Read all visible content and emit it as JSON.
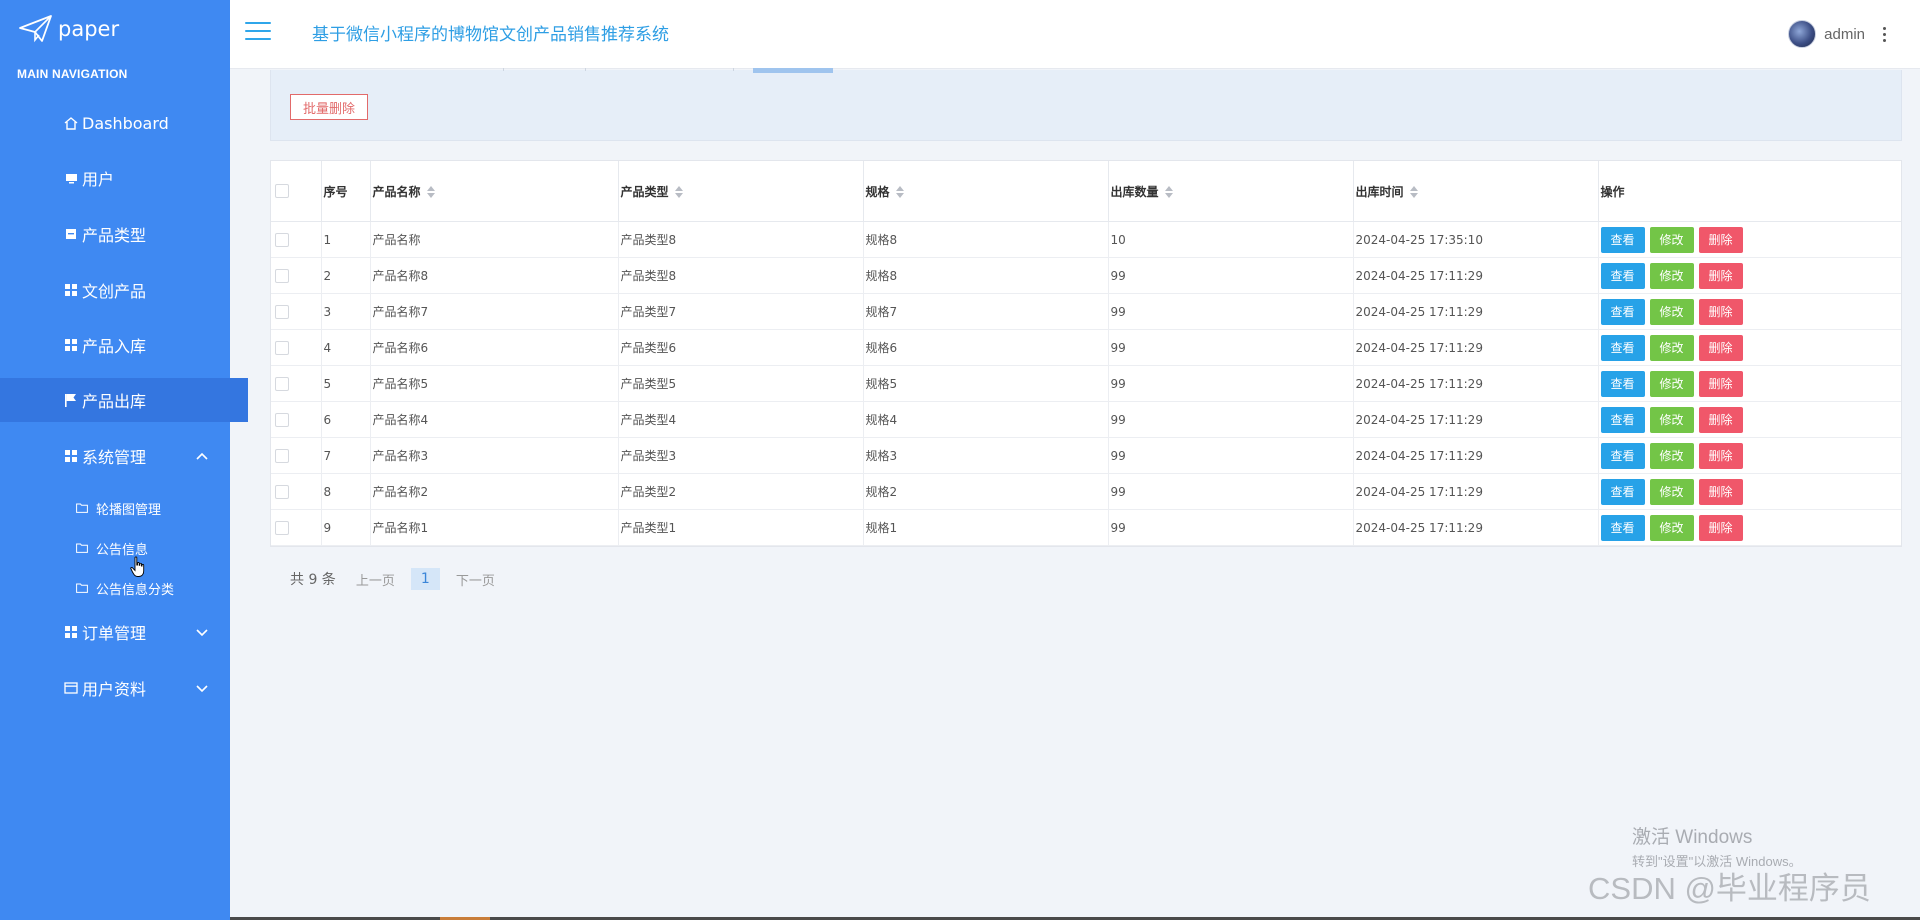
{
  "app": {
    "logo_text": "paper",
    "nav_header": "MAIN NAVIGATION",
    "title": "基于微信小程序的博物馆文创产品销售推荐系统"
  },
  "sidebar": {
    "items": [
      {
        "label": "Dashboard",
        "icon": "home-icon"
      },
      {
        "label": "用户",
        "icon": "monitor-icon"
      },
      {
        "label": "产品类型",
        "icon": "square-icon"
      },
      {
        "label": "文创产品",
        "icon": "grid-icon"
      },
      {
        "label": "产品入库",
        "icon": "grid-icon"
      },
      {
        "label": "产品出库",
        "icon": "flag-icon",
        "active": true
      },
      {
        "label": "系统管理",
        "icon": "grid-icon",
        "expanded": true
      },
      {
        "label": "订单管理",
        "icon": "grid-icon"
      },
      {
        "label": "用户资料",
        "icon": "calendar-icon"
      }
    ],
    "sub_items": [
      {
        "label": "轮播图管理",
        "icon": "folder-icon"
      },
      {
        "label": "公告信息",
        "icon": "folder-icon",
        "active": true
      },
      {
        "label": "公告信息分类",
        "icon": "folder-icon"
      }
    ]
  },
  "header": {
    "user_name": "admin"
  },
  "toolbar": {
    "batch_delete": "批量删除"
  },
  "table": {
    "columns": [
      "序号",
      "产品名称",
      "产品类型",
      "规格",
      "出库数量",
      "出库时间",
      "操作"
    ],
    "rows": [
      [
        "1",
        "产品名称",
        "产品类型8",
        "规格8",
        "10",
        "2024-04-25 17:35:10"
      ],
      [
        "2",
        "产品名称8",
        "产品类型8",
        "规格8",
        "99",
        "2024-04-25 17:11:29"
      ],
      [
        "3",
        "产品名称7",
        "产品类型7",
        "规格7",
        "99",
        "2024-04-25 17:11:29"
      ],
      [
        "4",
        "产品名称6",
        "产品类型6",
        "规格6",
        "99",
        "2024-04-25 17:11:29"
      ],
      [
        "5",
        "产品名称5",
        "产品类型5",
        "规格5",
        "99",
        "2024-04-25 17:11:29"
      ],
      [
        "6",
        "产品名称4",
        "产品类型4",
        "规格4",
        "99",
        "2024-04-25 17:11:29"
      ],
      [
        "7",
        "产品名称3",
        "产品类型3",
        "规格3",
        "99",
        "2024-04-25 17:11:29"
      ],
      [
        "8",
        "产品名称2",
        "产品类型2",
        "规格2",
        "99",
        "2024-04-25 17:11:29"
      ],
      [
        "9",
        "产品名称1",
        "产品类型1",
        "规格1",
        "99",
        "2024-04-25 17:11:29"
      ]
    ],
    "actions": {
      "view": "查看",
      "edit": "修改",
      "delete": "删除"
    }
  },
  "pagination": {
    "total": "共 9 条",
    "prev": "上一页",
    "current": "1",
    "next": "下一页"
  },
  "overlay": {
    "activate_title": "激活 Windows",
    "activate_sub": "转到\"设置\"以激活 Windows。",
    "watermark": "CSDN @毕业程序员"
  },
  "colors": {
    "sidebar_bg": "#3f89f2",
    "sidebar_active": "#3476e0",
    "title_color": "#2e9ee4",
    "view_button": "#27a2e8",
    "edit_button": "#73c547",
    "delete_button": "#f0576a"
  }
}
